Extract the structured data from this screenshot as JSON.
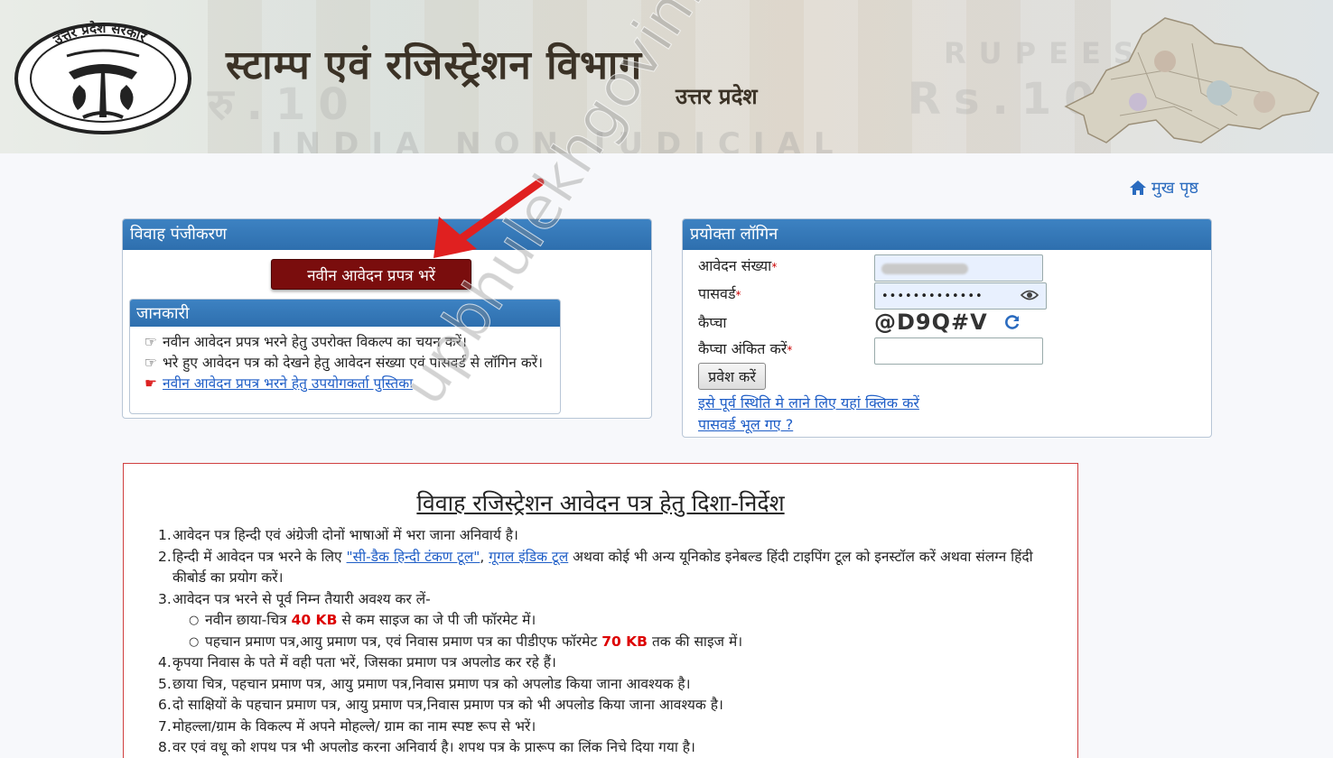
{
  "banner": {
    "title": "स्टाम्प एवं रजिस्ट्रेशन विभाग",
    "subtitle": "उत्तर प्रदेश",
    "emblem_text": "उत्तर प्रदेश सरकार",
    "stamp_text_bottom": "INDIA NON JUDICIAL",
    "stamp_text_left": "रु.10",
    "stamp_text_right": "Rs.10",
    "stamp_text_top_right": "RUPEES"
  },
  "nav": {
    "home_label": "मुख पृष्ठ",
    "home_icon": "home-icon"
  },
  "vivah_panel": {
    "title": "विवाह पंजीकरण",
    "new_form_button": "नवीन आवेदन प्रपत्र भरें",
    "info": {
      "title": "जानकारी",
      "items": [
        "नवीन आवेदन प्रपत्र भरने हेतु उपरोक्त विकल्प का चयन करें।",
        "भरे हुए आवेदन पत्र को देखने हेतु आवेदन संख्या एवं पासवर्ड से लॉगिन करें।"
      ],
      "manual_link": "नवीन आवेदन प्रपत्र भरने हेतु उपयोगकर्ता पुस्तिका"
    }
  },
  "login_panel": {
    "title": "प्रयोक्ता लॉगिन",
    "application_no_label": "आवेदन संख्या",
    "password_label": "पासवर्ड",
    "password_value": "•••••••••••••",
    "captcha_label": "कैप्चा",
    "captcha_value": "@D9Q#V",
    "captcha_input_label": "कैप्चा अंकित करें",
    "submit_label": "प्रवेश करें",
    "restore_link": "इसे पूर्व स्थिति मे लाने लिए यहां क्लिक करें",
    "forgot_link": "पासवर्ड भूल गए ?"
  },
  "guidelines": {
    "title": "विवाह रजिस्ट्रेशन आवेदन पत्र हेतु दिशा-निर्देश",
    "item1": "आवेदन पत्र हिन्दी एवं अंग्रेजी दोनों भाषाओं में भरा जाना अनिवार्य है।",
    "item2_prefix": "हिन्दी में आवेदन पत्र भरने के लिए",
    "item2_link1": "\"सी-डैक हिन्दी टंकण टूल\"",
    "item2_link2": "गूगल इंडिक टूल",
    "item2_suffix": "अथवा कोई भी अन्य यूनिकोड इनेबल्ड हिंदी टाइपिंग टूल को इनस्टॉल करें अथवा संलग्न हिंदी कीबोर्ड का प्रयोग करें।",
    "item3": "आवेदन पत्र भरने से पूर्व निम्न तैयारी अवश्य कर लें-",
    "item3_sub1_prefix": "नवीन छाया-चित्र",
    "item3_sub1_size": "40 KB",
    "item3_sub1_suffix": "से कम साइज का जे पी जी फॉरमेट में।",
    "item3_sub2_prefix": "पहचान प्रमाण पत्र,आयु प्रमाण पत्र, एवं निवास प्रमाण पत्र का पीडीएफ फॉरमेट",
    "item3_sub2_size": "70 KB",
    "item3_sub2_suffix": "तक की साइज में।",
    "item4": "कृपया निवास के पते में वही पता भरें, जिसका प्रमाण पत्र अपलोड कर रहे हैं।",
    "item5": "छाया चित्र, पहचान प्रमाण पत्र, आयु प्रमाण पत्र,निवास प्रमाण पत्र को अपलोड किया जाना आवश्यक है।",
    "item6": "दो साक्षियों के पहचान प्रमाण पत्र, आयु प्रमाण पत्र,निवास प्रमाण पत्र को भी अपलोड किया जाना आवश्यक है।",
    "item7": "मोहल्ला/ग्राम के विकल्प में अपने मोहल्ले/ ग्राम का नाम स्पष्ट रूप से भरें।",
    "item8": "वर एवं वधू को शपथ पत्र भी अपलोड करना अनिवार्य है। शपथ पत्र के प्रारूप का लिंक निचे दिया गया है।"
  },
  "overlay": {
    "watermark": "upbhulekhgovin.com",
    "arrow_color": "#e02020"
  }
}
